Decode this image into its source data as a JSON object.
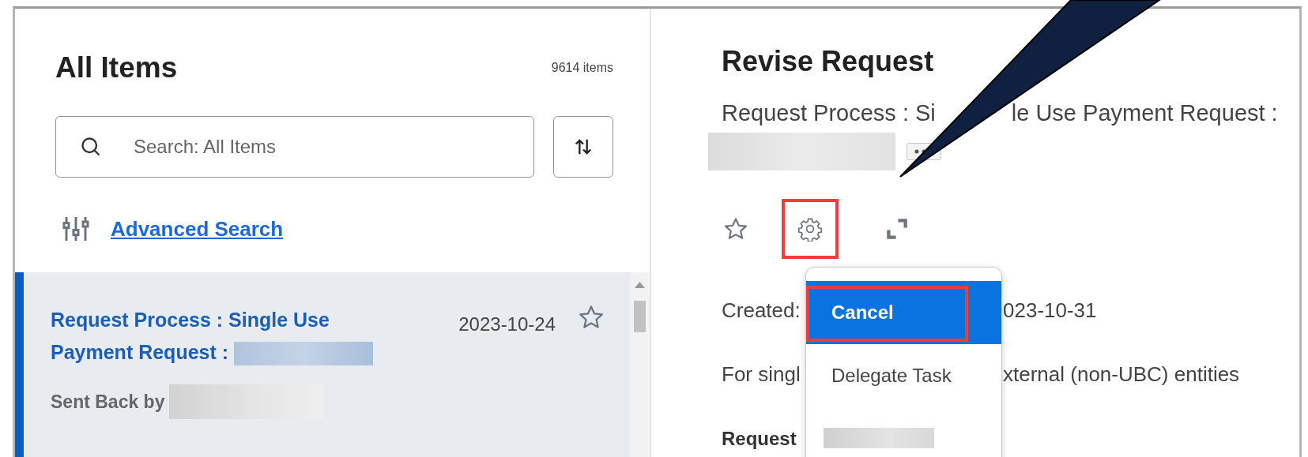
{
  "list_panel": {
    "title": "All Items",
    "count": "9614 items",
    "search": {
      "placeholder": "Search: All Items"
    },
    "advanced_search": "Advanced Search",
    "items": [
      {
        "title": "Request Process : Single Use Payment Request :",
        "date": "2023-10-24",
        "status": "Sent Back by",
        "selected": true,
        "starred": false
      }
    ]
  },
  "detail_panel": {
    "title": "Revise Request",
    "subtitle_start": "Request Process : Si",
    "subtitle_end": "le Use Payment Request :",
    "actions": [
      {
        "kind": "star",
        "highlighted": false
      },
      {
        "kind": "gear",
        "highlighted": true
      },
      {
        "kind": "expand",
        "highlighted": false
      }
    ],
    "created_label": "Created:",
    "created_date": "023-10-31",
    "description_start": "For singl",
    "description_end": "xternal (non-UBC) entities",
    "section_heading": "Request"
  },
  "menu": {
    "items": [
      {
        "kind": "text",
        "label": "Cancel",
        "selected": true,
        "highlighted": true
      },
      {
        "kind": "text",
        "label": "Delegate Task",
        "selected": false,
        "highlighted": false
      },
      {
        "kind": "redacted",
        "selected": false,
        "highlighted": false
      }
    ]
  }
}
